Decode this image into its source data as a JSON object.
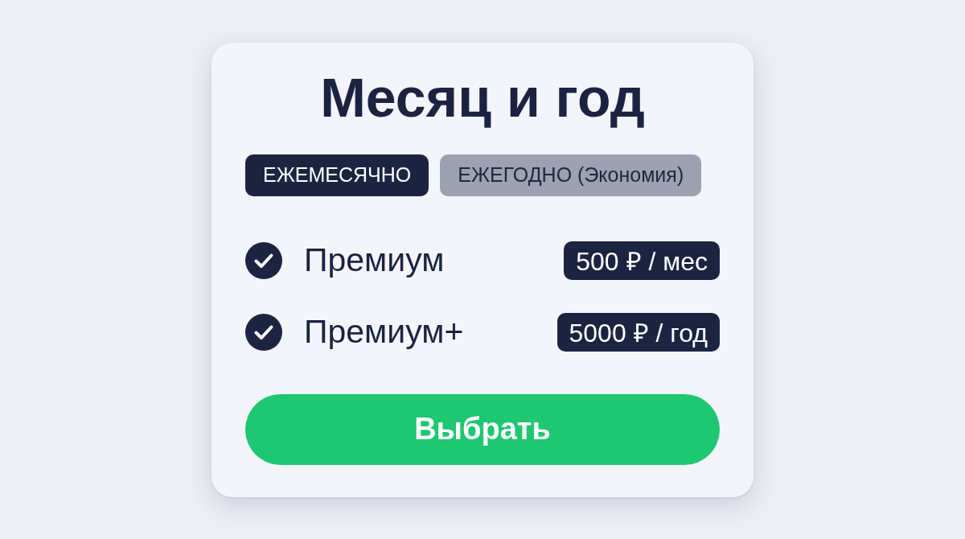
{
  "card": {
    "title": "Месяц и год",
    "tabs": [
      {
        "label": "ЕЖЕМЕСЯЧНО",
        "selected": true
      },
      {
        "label": "ЕЖЕГОДНО (Экономия)",
        "selected": false
      }
    ],
    "plans": [
      {
        "name": "Премиум",
        "checked": true,
        "price": "500 ₽ / мес"
      },
      {
        "name": "Премиум+",
        "checked": true,
        "price": "5000 ₽ / год"
      }
    ],
    "button": "Выбрать"
  }
}
